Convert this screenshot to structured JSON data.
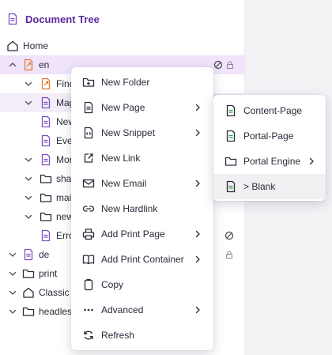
{
  "panel": {
    "title": "Document Tree",
    "icon": "document-icon"
  },
  "tree": [
    {
      "name": "home",
      "label": "Home"
    },
    {
      "name": "en",
      "label": "en"
    },
    {
      "name": "find",
      "label": "Find"
    },
    {
      "name": "mag",
      "label": "Mag"
    },
    {
      "name": "new",
      "label": "New"
    },
    {
      "name": "ever",
      "label": "Even"
    },
    {
      "name": "mor",
      "label": "Mor"
    },
    {
      "name": "shar",
      "label": "shar"
    },
    {
      "name": "mail",
      "label": "mail"
    },
    {
      "name": "new-folder",
      "label": "new"
    },
    {
      "name": "erro",
      "label": "Erro"
    },
    {
      "name": "de",
      "label": "de"
    },
    {
      "name": "print",
      "label": "print"
    },
    {
      "name": "classic",
      "label": "Classic"
    },
    {
      "name": "headless",
      "label": "headles"
    }
  ],
  "context_menu": {
    "items": [
      {
        "label": "New Folder",
        "icon": "folder-plus-icon"
      },
      {
        "label": "New Page",
        "icon": "page-icon",
        "submenu": true
      },
      {
        "label": "New Snippet",
        "icon": "snippet-icon",
        "submenu": true
      },
      {
        "label": "New Link",
        "icon": "link-icon"
      },
      {
        "label": "New Email",
        "icon": "email-icon",
        "submenu": true
      },
      {
        "label": "New Hardlink",
        "icon": "hardlink-icon"
      },
      {
        "label": "Add Print Page",
        "icon": "printer-icon",
        "submenu": true
      },
      {
        "label": "Add Print Container",
        "icon": "book-icon",
        "submenu": true
      },
      {
        "label": "Copy",
        "icon": "copy-icon"
      },
      {
        "label": "Advanced",
        "icon": "more-icon",
        "submenu": true
      },
      {
        "label": "Refresh",
        "icon": "refresh-icon"
      }
    ]
  },
  "submenu": {
    "items": [
      {
        "label": "Content-Page",
        "icon": "page-icon"
      },
      {
        "label": "Portal-Page",
        "icon": "page-icon"
      },
      {
        "label": "Portal Engine",
        "icon": "folder-icon",
        "submenu": true
      },
      {
        "label": "> Blank",
        "icon": "page-icon",
        "active": true
      }
    ]
  },
  "colors": {
    "accent": "#5b2aa0",
    "document": "#7c4fc4",
    "orange": "#e07a2e",
    "selected_row": "#efe4fb"
  }
}
